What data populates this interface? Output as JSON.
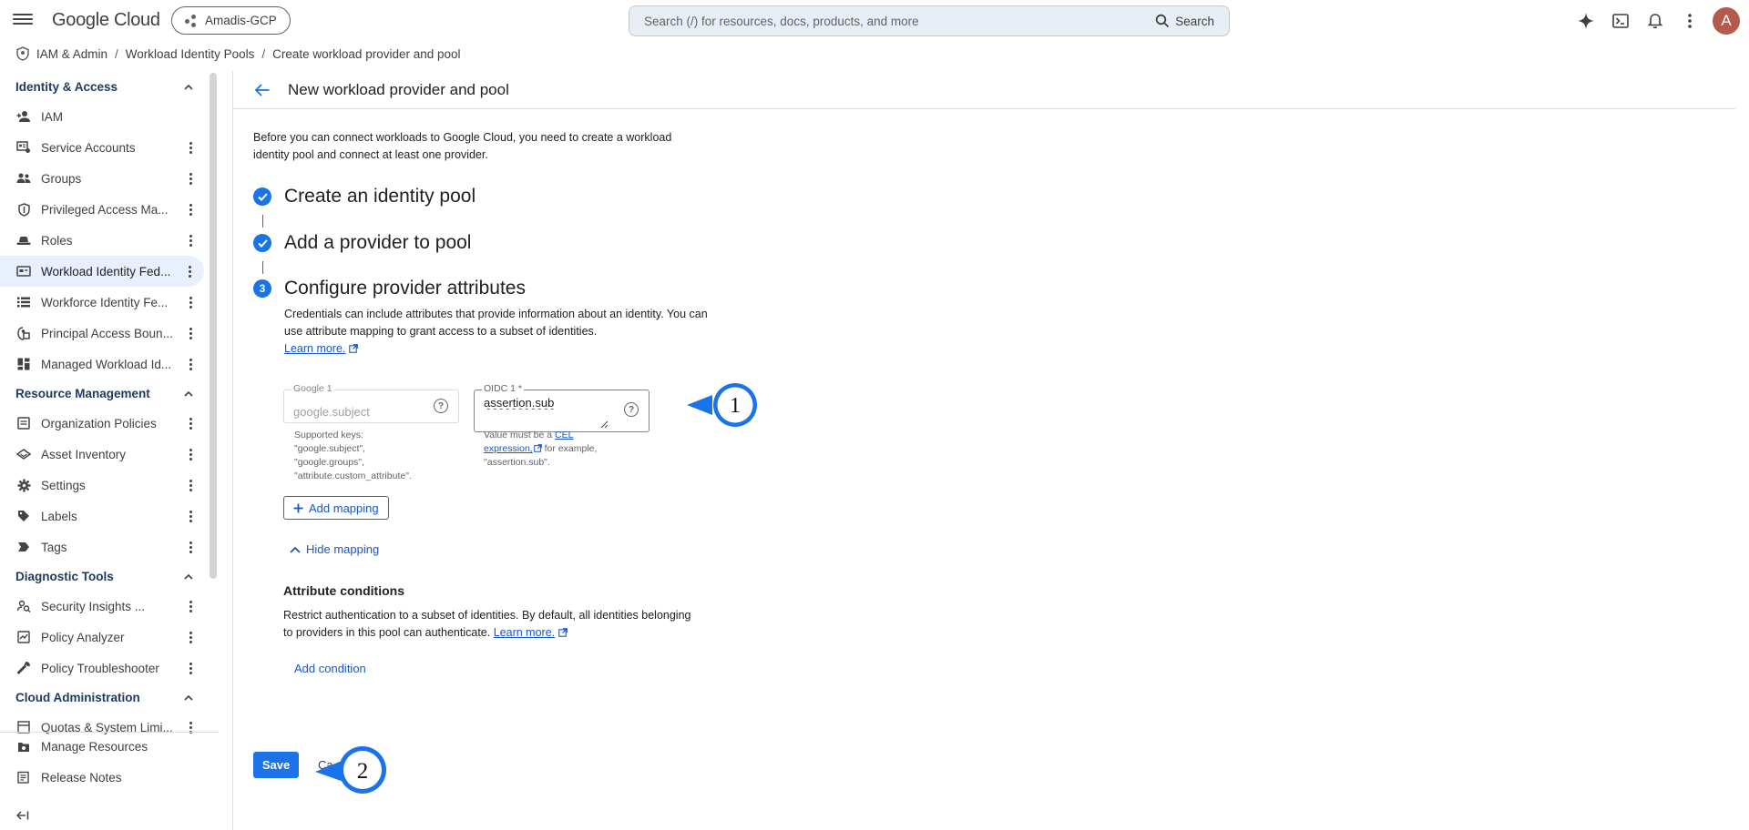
{
  "topbar": {
    "logo": "Google Cloud",
    "project": "Amadis-GCP",
    "search_placeholder": "Search (/) for resources, docs, products, and more",
    "search_button": "Search",
    "avatar_letter": "A"
  },
  "breadcrumb": {
    "root": "IAM & Admin",
    "items": [
      "Workload Identity Pools",
      "Create workload provider and pool"
    ]
  },
  "sidebar": {
    "sections": [
      {
        "title": "Identity & Access",
        "items": [
          {
            "label": "IAM",
            "icon": "person-add-icon"
          },
          {
            "label": "Service Accounts",
            "icon": "service-account-icon"
          },
          {
            "label": "Groups",
            "icon": "groups-icon"
          },
          {
            "label": "Privileged Access Ma...",
            "icon": "shield-icon"
          },
          {
            "label": "Roles",
            "icon": "hat-icon"
          },
          {
            "label": "Workload Identity Fed...",
            "icon": "id-card-icon",
            "active": true
          },
          {
            "label": "Workforce Identity Fe...",
            "icon": "list-icon"
          },
          {
            "label": "Principal Access Boun...",
            "icon": "boundary-icon"
          },
          {
            "label": "Managed Workload Id...",
            "icon": "dashboard-icon"
          }
        ]
      },
      {
        "title": "Resource Management",
        "items": [
          {
            "label": "Organization Policies",
            "icon": "policy-doc-icon"
          },
          {
            "label": "Asset Inventory",
            "icon": "layers-icon"
          },
          {
            "label": "Settings",
            "icon": "gear-icon"
          },
          {
            "label": "Labels",
            "icon": "label-tag-icon"
          },
          {
            "label": "Tags",
            "icon": "tag-arrow-icon"
          }
        ]
      },
      {
        "title": "Diagnostic Tools",
        "items": [
          {
            "label": "Security Insights ...",
            "icon": "insights-icon"
          },
          {
            "label": "Policy Analyzer",
            "icon": "analyzer-icon"
          },
          {
            "label": "Policy Troubleshooter",
            "icon": "wrench-icon"
          }
        ]
      },
      {
        "title": "Cloud Administration",
        "items": [
          {
            "label": "Quotas & System Limi...",
            "icon": "quota-icon"
          }
        ]
      }
    ],
    "bottom_items": [
      {
        "label": "Manage Resources",
        "icon": "folder-gear-icon"
      },
      {
        "label": "Release Notes",
        "icon": "notes-icon"
      }
    ]
  },
  "main": {
    "title": "New workload provider and pool",
    "intro": "Before you can connect workloads to Google Cloud, you need to create a workload identity pool and connect at least one provider.",
    "steps": [
      {
        "title": "Create an identity pool",
        "status": "done"
      },
      {
        "title": "Add a provider to pool",
        "status": "done"
      },
      {
        "title": "Configure provider attributes",
        "status": "current",
        "number": "3"
      }
    ],
    "step3_description": "Credentials can include attributes that provide information about an identity. You can use attribute mapping to grant access to a subset of identities.",
    "learn_more": "Learn more.",
    "google_field": {
      "label": "Google 1",
      "placeholder": "google.subject",
      "hint": "Supported keys: \"google.subject\", \"google.groups\", \"attribute.custom_attribute\"."
    },
    "oidc_field": {
      "label": "OIDC 1 *",
      "value": "assertion.sub",
      "hint_prefix": "Value must be a",
      "hint_link": "CEL expression,",
      "hint_suffix": "for example, \"assertion.sub\"."
    },
    "add_mapping": "Add mapping",
    "hide_mapping": "Hide mapping",
    "attribute_conditions_title": "Attribute conditions",
    "attribute_conditions_desc": "Restrict authentication to a subset of identities. By default, all identities belonging to providers in this pool can authenticate.",
    "conditions_learn_more": "Learn more.",
    "add_condition": "Add condition",
    "save": "Save",
    "cancel": "Ca"
  },
  "callouts": [
    "1",
    "2"
  ],
  "colors": {
    "accent": "#1a73e8",
    "link": "#1a55c6",
    "active_nav": "#e8f0fe",
    "section_header": "#1f3a63"
  }
}
